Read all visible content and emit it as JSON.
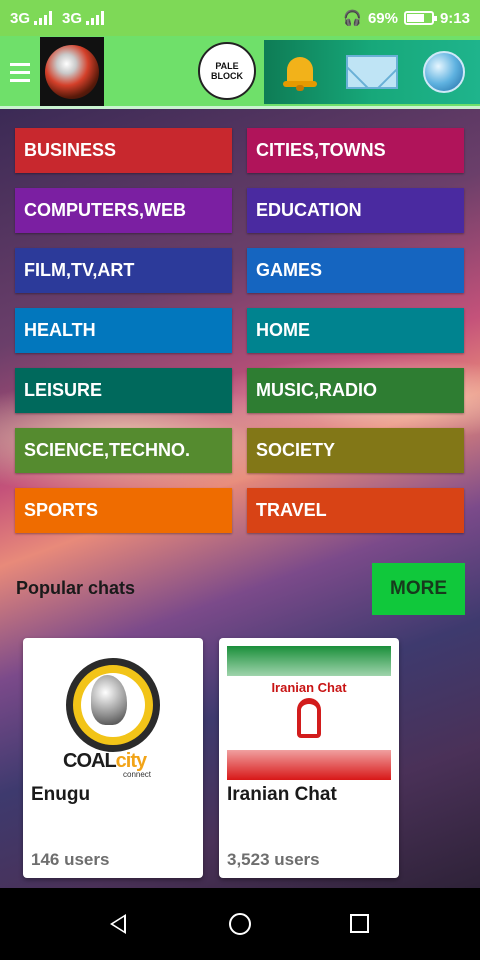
{
  "status_bar": {
    "network_1": "3G",
    "network_2": "3G",
    "network_2_sup": "3G",
    "headset_icon": "headset-icon",
    "battery_percent": "69%",
    "battery_level": 0.69,
    "time": "9:13"
  },
  "app_bar": {
    "menu_icon": "hamburger-icon",
    "badge_text": "PALE\nBLOCK",
    "icons": [
      "bell-icon",
      "mail-icon",
      "globe-icon"
    ]
  },
  "categories": [
    {
      "label": "BUSINESS",
      "color": "#c8282e"
    },
    {
      "label": "CITIES,TOWNS",
      "color": "#b0145a"
    },
    {
      "label": "COMPUTERS,WEB",
      "color": "#7b1fa2"
    },
    {
      "label": "EDUCATION",
      "color": "#4a2aa0"
    },
    {
      "label": "FILM,TV,ART",
      "color": "#2c3a9a"
    },
    {
      "label": "GAMES",
      "color": "#1565c0"
    },
    {
      "label": "HEALTH",
      "color": "#0277bd"
    },
    {
      "label": "HOME",
      "color": "#00838f"
    },
    {
      "label": "LEISURE",
      "color": "#00695c"
    },
    {
      "label": "MUSIC,RADIO",
      "color": "#2e7d32"
    },
    {
      "label": "SCIENCE,TECHNO.",
      "color": "#558b2f"
    },
    {
      "label": "SOCIETY",
      "color": "#827717"
    },
    {
      "label": "SPORTS",
      "color": "#ef6c00"
    },
    {
      "label": "TRAVEL",
      "color": "#d84315"
    }
  ],
  "popular": {
    "label": "Popular chats",
    "more_label": "MORE",
    "chats": [
      {
        "name": "Enugu",
        "users": "146 users",
        "brand_coal": "COAL",
        "brand_city": "city",
        "brand_sub": "connect"
      },
      {
        "name": "Iranian Chat",
        "users": "3,523 users",
        "banner_title": "Iranian Chat"
      }
    ]
  },
  "nav_bar": {
    "icons": [
      "back-icon",
      "home-icon",
      "recent-apps-icon"
    ]
  }
}
